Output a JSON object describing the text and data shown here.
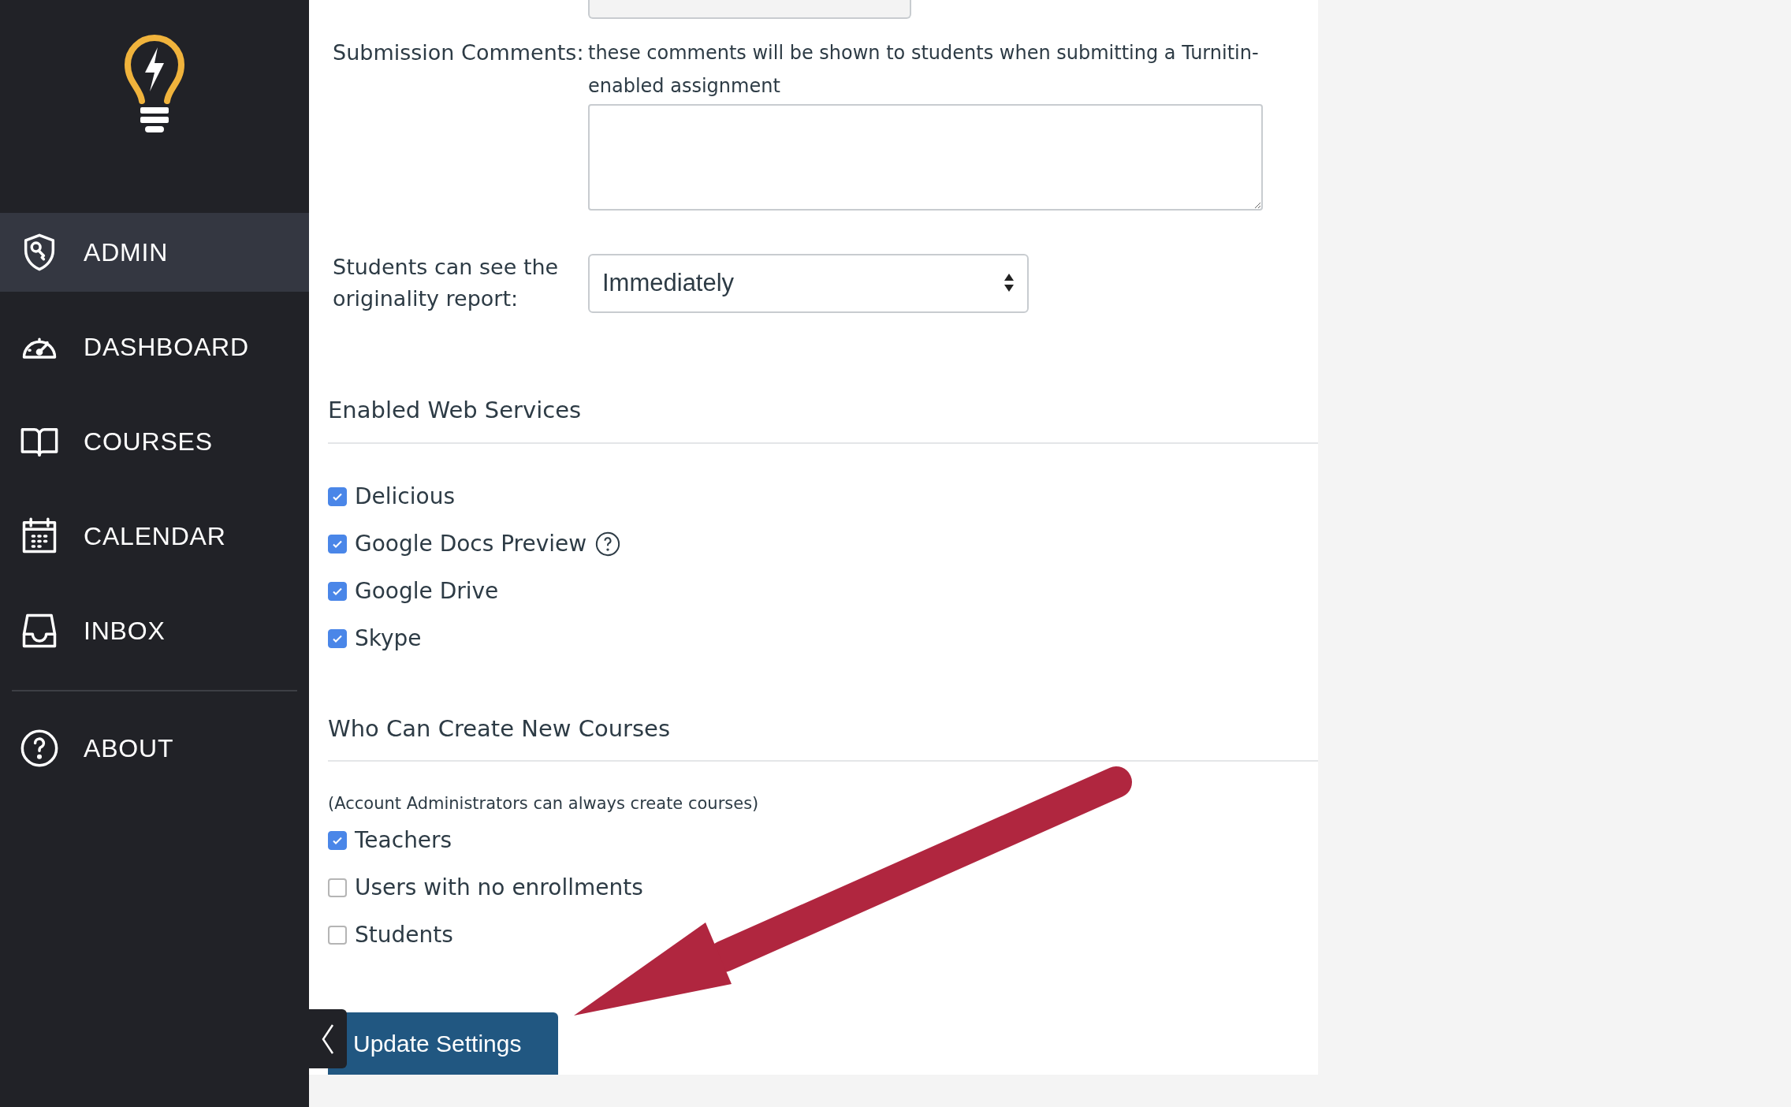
{
  "sidebar": {
    "items": [
      {
        "label": "ADMIN",
        "kind": "admin",
        "selected": true
      },
      {
        "label": "DASHBOARD",
        "kind": "dashboard",
        "selected": false
      },
      {
        "label": "COURSES",
        "kind": "courses",
        "selected": false
      },
      {
        "label": "CALENDAR",
        "kind": "calendar",
        "selected": false
      },
      {
        "label": "INBOX",
        "kind": "inbox",
        "selected": false
      }
    ],
    "footer_items": [
      {
        "label": "ABOUT",
        "kind": "about",
        "selected": false
      }
    ]
  },
  "form": {
    "submission_comments": {
      "label": "Submission Comments:",
      "hint": "these comments will be shown to students when submitting a Turnitin-enabled assignment"
    },
    "originality_report": {
      "label": "Students can see the originality report:",
      "value": "Immediately"
    }
  },
  "web_services": {
    "heading": "Enabled Web Services",
    "options": [
      {
        "label": "Delicious",
        "checked": true,
        "help": false
      },
      {
        "label": "Google Docs Preview",
        "checked": true,
        "help": true
      },
      {
        "label": "Google Drive",
        "checked": true,
        "help": false
      },
      {
        "label": "Skype",
        "checked": true,
        "help": false
      }
    ]
  },
  "course_creation": {
    "heading": "Who Can Create New Courses",
    "note": "(Account Administrators can always create courses)",
    "options": [
      {
        "label": "Teachers",
        "checked": true
      },
      {
        "label": "Users with no enrollments",
        "checked": false
      },
      {
        "label": "Students",
        "checked": false
      }
    ]
  },
  "submit_button": "Update Settings"
}
